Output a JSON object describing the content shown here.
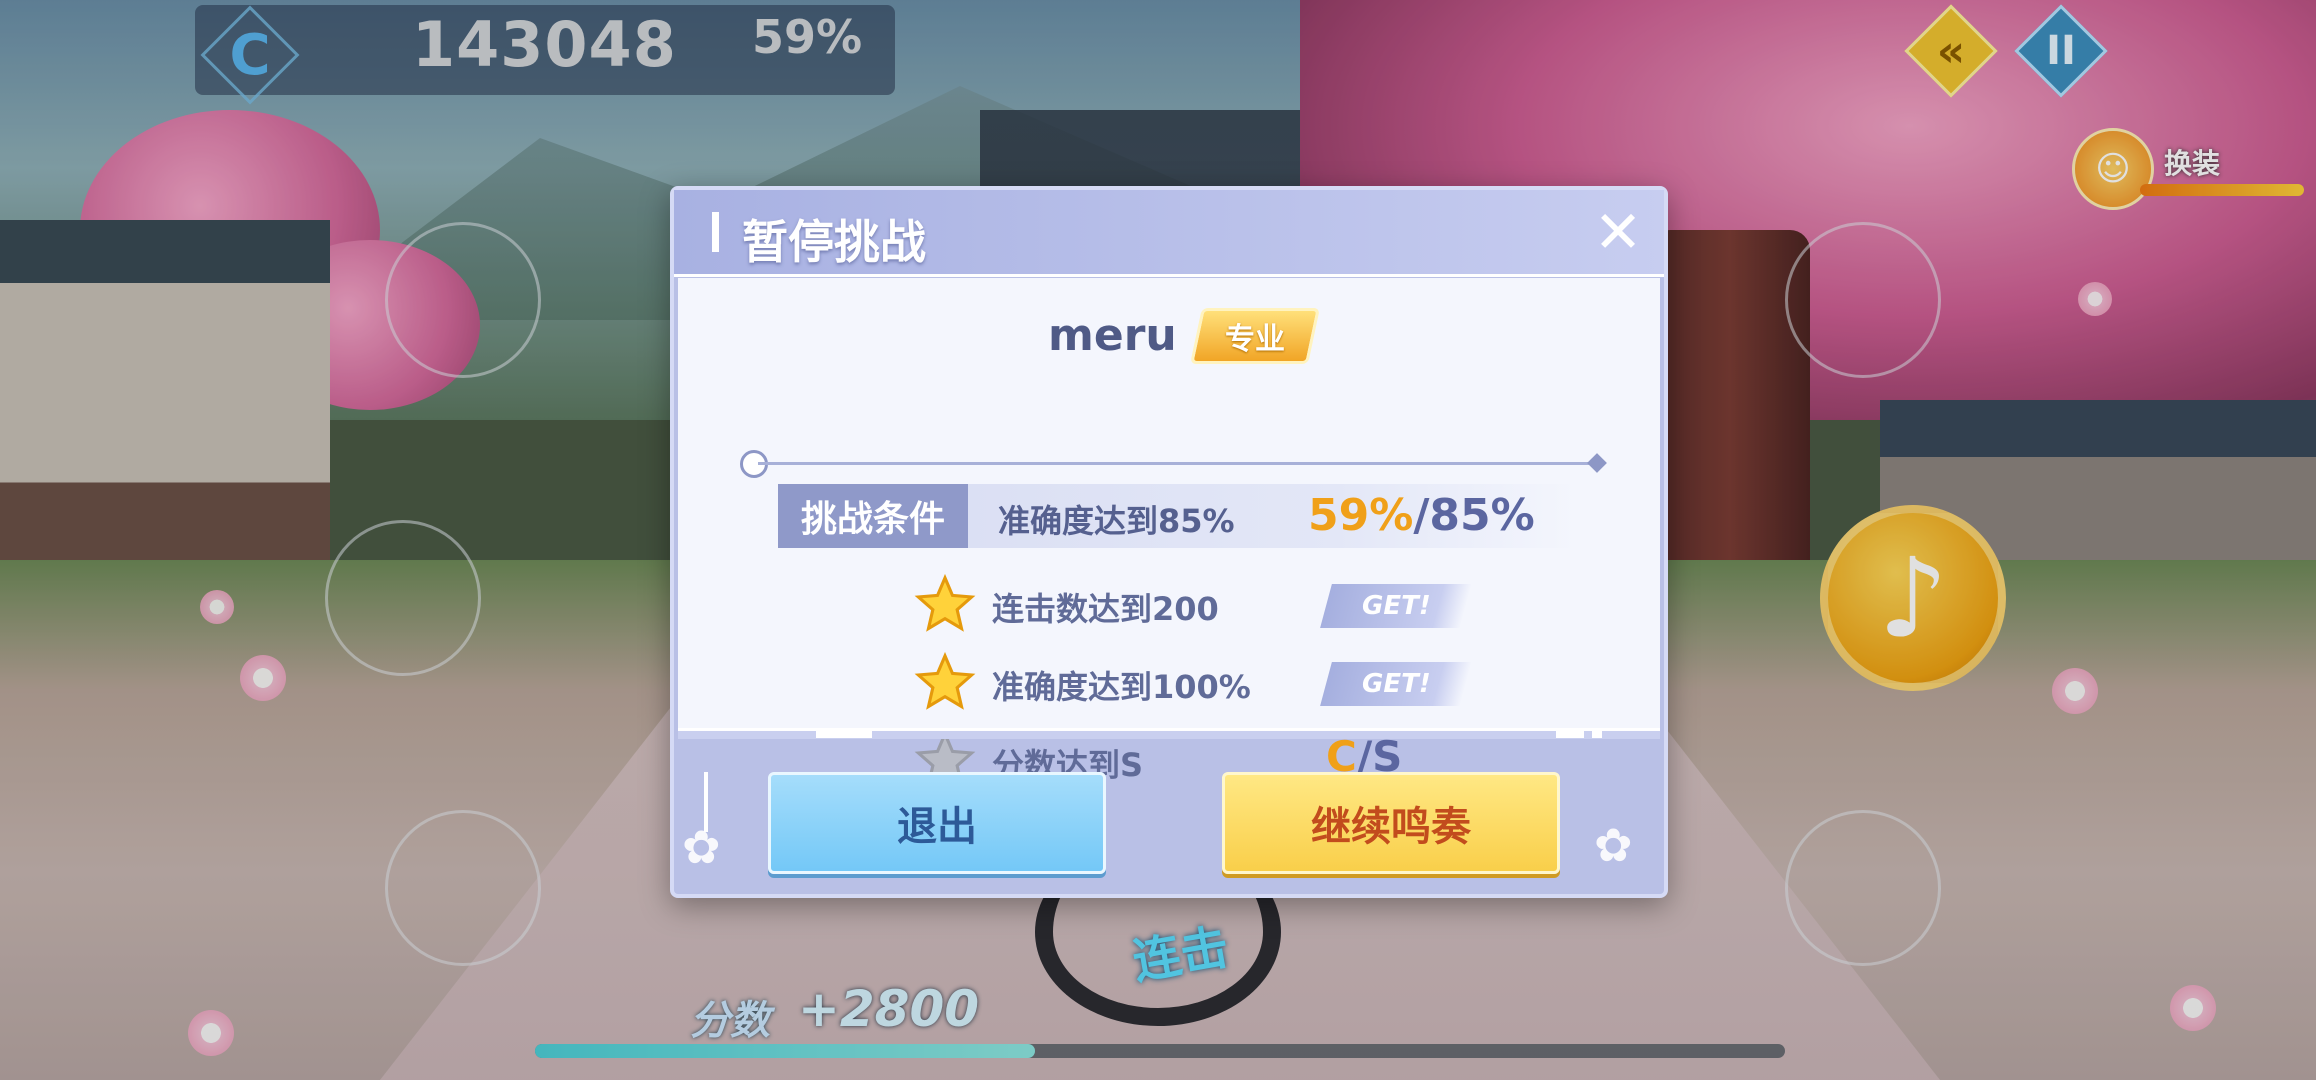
{
  "hud": {
    "rank": "C",
    "score": "143048",
    "accuracy": "59%",
    "back_icon": "«",
    "pause_icon": "II",
    "outfit_label": "换装",
    "combo_label": "连击",
    "score_label": "分数",
    "score_gain": "+2800",
    "progress": 0.4
  },
  "dialog": {
    "title": "暂停挑战",
    "close_icon": "✕",
    "song": "meru",
    "difficulty": "专业",
    "condition_tag": "挑战条件",
    "condition_text": "准确度达到85%",
    "condition_current": "59%",
    "condition_slash": "/",
    "condition_target": "85%",
    "tasks": [
      {
        "text": "连击数达到200",
        "status": "GET!",
        "achieved": true
      },
      {
        "text": "准确度达到100%",
        "status": "GET!",
        "achieved": true
      },
      {
        "text": "分数达到S",
        "achieved": false,
        "current": "C",
        "slash": "/",
        "target": "S"
      }
    ],
    "exit_label": "退出",
    "continue_label": "继续鸣奏"
  },
  "colors": {
    "accent_orange": "#f0a019",
    "dialog_purple": "#8f99c9",
    "exit_blue": "#74c8f7",
    "continue_yellow": "#f9cf4a"
  }
}
